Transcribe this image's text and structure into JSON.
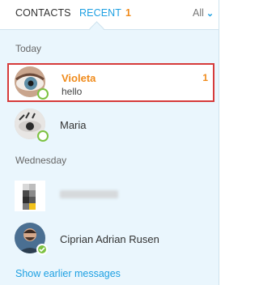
{
  "tabs": {
    "contacts": "CONTACTS",
    "recent": "RECENT",
    "recent_count": "1",
    "filter": "All"
  },
  "groups": {
    "today": "Today",
    "wednesday": "Wednesday"
  },
  "conversations": [
    {
      "name": "Violeta",
      "message": "hello",
      "unread": "1",
      "status": "away"
    },
    {
      "name": "Maria",
      "message": "",
      "unread": "",
      "status": "away"
    },
    {
      "name": "",
      "message": "",
      "unread": "",
      "status": "pixelated"
    },
    {
      "name": "Ciprian Adrian Rusen",
      "message": "",
      "unread": "",
      "status": "online"
    }
  ],
  "footer": {
    "show_earlier": "Show earlier messages"
  },
  "colors": {
    "accent": "#1ea0e2",
    "unread": "#f08b1b",
    "selection_border": "#d63b3b",
    "presence": "#7dc242",
    "panel_bg": "#eaf6fd"
  },
  "icons": {
    "filter": "chevron-down-icon",
    "presence": "presence-icon"
  }
}
